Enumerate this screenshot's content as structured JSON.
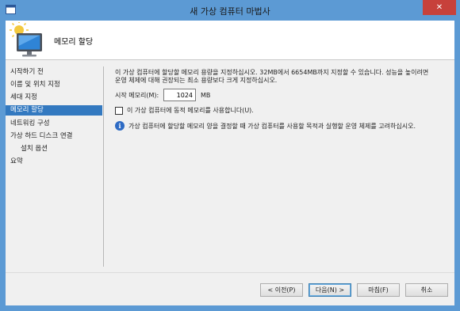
{
  "window": {
    "title": "새 가상 컴퓨터 마법사",
    "close_glyph": "✕",
    "frame_color": "#5c9ad4",
    "close_color": "#c7413b"
  },
  "banner": {
    "title": "메모리 할당",
    "icon": "virtual-machine-monitor-icon"
  },
  "nav": {
    "active_color": "#3379c0",
    "items": [
      {
        "label": "시작하기 전",
        "active": false
      },
      {
        "label": "이름 및 위치 지정",
        "active": false
      },
      {
        "label": "세대 지정",
        "active": false
      },
      {
        "label": "메모리 할당",
        "active": true
      },
      {
        "label": "네트워킹 구성",
        "active": false
      },
      {
        "label": "가상 하드 디스크 연결",
        "active": false
      },
      {
        "label": "설치 옵션",
        "active": false
      },
      {
        "label": "요약",
        "active": false
      }
    ]
  },
  "content": {
    "description_line1": "이 가상 컴퓨터에 할당할 메모리 용량을 지정하십시오. 32MB에서 6654MB까지 지정할 수 있습니다. 성능을 높이려면",
    "description_line2": "운영 체제에 대해 권장되는 최소 용량보다 크게 지정하십시오.",
    "startup_memory_label": "시작 메모리(M):",
    "startup_memory_value": "1024",
    "startup_memory_unit": "MB",
    "dynamic_memory_label": "이 가상 컴퓨터에 동적 메모리를 사용합니다(U).",
    "dynamic_memory_checked": false,
    "info_icon": "information-icon",
    "info_text": "가상 컴퓨터에 할당할 메모리 양을 결정할 때 가상 컴퓨터를 사용할 목적과 실행할 운영 체제를 고려하십시오."
  },
  "buttons": {
    "previous": "< 이전(P)",
    "next": "다음(N) >",
    "finish": "마침(F)",
    "cancel": "취소"
  }
}
